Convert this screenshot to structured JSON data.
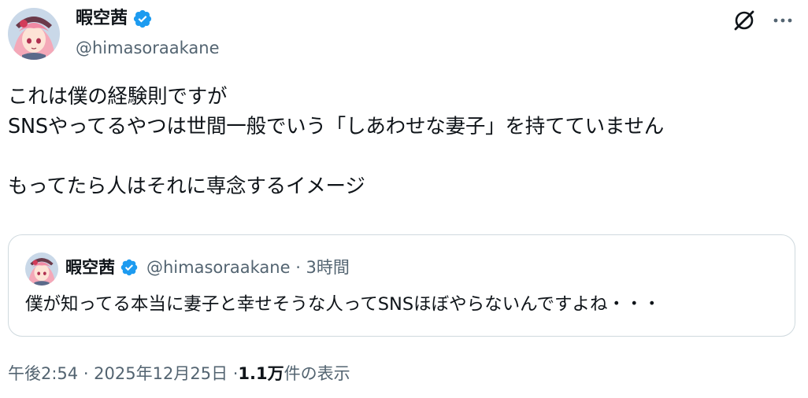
{
  "author": {
    "display_name": "暇空茜",
    "handle": "@himasoraakane",
    "verified_icon": "verified-badge-icon",
    "badge_color": "#1d9bf0"
  },
  "header_icons": {
    "grok": "grok-icon",
    "more": "more-icon"
  },
  "tweet": {
    "lines": [
      "これは僕の経験則ですが",
      "SNSやってるやつは世間一般でいう「しあわせな妻子」を持てていません",
      "",
      "もってたら人はそれに専念するイメージ"
    ]
  },
  "quote": {
    "display_name": "暇空茜",
    "meta": "@himasoraakane · 3時間",
    "text": "僕が知ってる本当に妻子と幸せそうな人ってSNSほぼやらないんですよね・・・"
  },
  "footer": {
    "timestamp": "午後2:54 · 2025年12月25日 · ",
    "views_count": "1.1万",
    "views_label": " 件の表示"
  },
  "colors": {
    "text": "#0f1419",
    "secondary": "#536471",
    "border": "#cfd9de",
    "accent": "#1d9bf0"
  }
}
